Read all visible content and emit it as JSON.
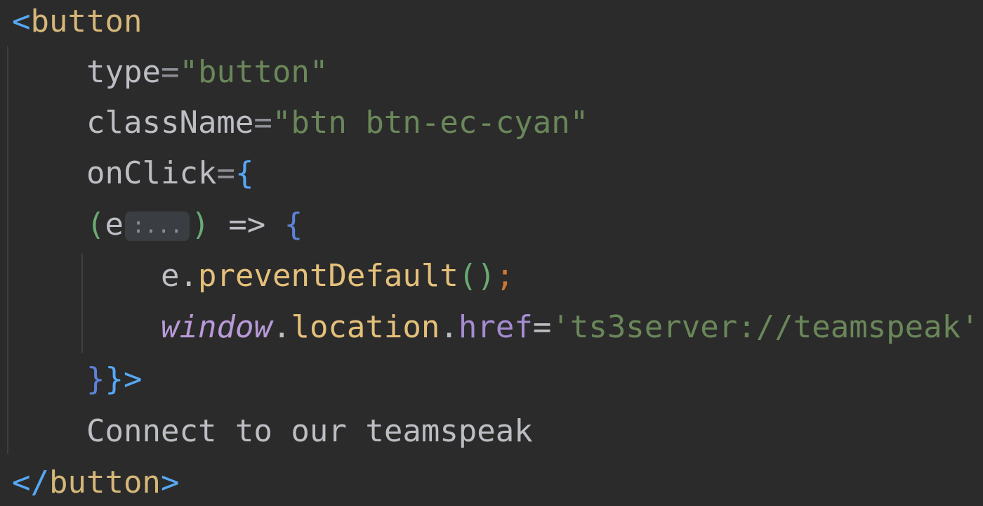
{
  "code": {
    "line1": {
      "open_bracket": "<",
      "tag": "button"
    },
    "line2": {
      "attr": "type",
      "eq": "=",
      "value": "\"button\""
    },
    "line3": {
      "attr": "className",
      "eq": "=",
      "value": "\"btn btn-ec-cyan\""
    },
    "line4": {
      "attr": "onClick",
      "eq": "=",
      "brace": "{"
    },
    "line5": {
      "open_paren": "(",
      "param": "e",
      "hint": ":...",
      "close_paren": ")",
      "arrow": " => ",
      "brace": "{"
    },
    "line6": {
      "obj": "e",
      "dot": ".",
      "method": "preventDefault",
      "parens": "()",
      "semi": ";"
    },
    "line7": {
      "obj": "window",
      "dot1": ".",
      "prop1": "location",
      "dot2": ".",
      "prop2": "href",
      "eq": "=",
      "value": "'ts3server://teamspeak'"
    },
    "line8": {
      "close_inner": "}",
      "close_outer": "}",
      "gt": ">"
    },
    "line9": {
      "text": "Connect to our teamspeak"
    },
    "line10": {
      "open_bracket": "</",
      "tag": "button",
      "gt": ">"
    }
  }
}
